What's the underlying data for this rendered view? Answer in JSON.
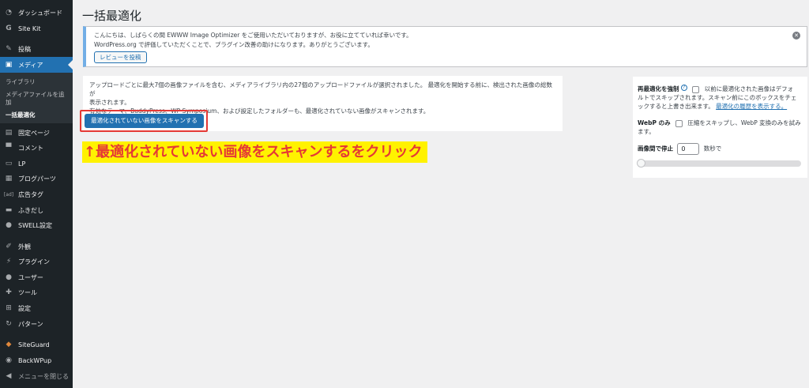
{
  "sidebar": {
    "items": [
      {
        "label": "ダッシュボード",
        "icon": "dashboard-icon"
      },
      {
        "label": "Site Kit",
        "icon": "sitekit-icon"
      },
      {
        "label": "投稿",
        "icon": "pin-icon"
      },
      {
        "label": "メディア",
        "icon": "media-icon"
      },
      {
        "label": "固定ページ",
        "icon": "page-icon"
      },
      {
        "label": "コメント",
        "icon": "comment-icon"
      },
      {
        "label": "LP",
        "icon": "lp-icon"
      },
      {
        "label": "ブログパーツ",
        "icon": "blogparts-icon"
      },
      {
        "label": "広告タグ",
        "icon": "ad-icon"
      },
      {
        "label": "ふきだし",
        "icon": "balloon-icon"
      },
      {
        "label": "SWELL設定",
        "icon": "swell-icon"
      },
      {
        "label": "外観",
        "icon": "brush-icon"
      },
      {
        "label": "プラグイン",
        "icon": "plugin-icon"
      },
      {
        "label": "ユーザー",
        "icon": "user-icon"
      },
      {
        "label": "ツール",
        "icon": "wrench-icon"
      },
      {
        "label": "設定",
        "icon": "settings-icon"
      },
      {
        "label": "パターン",
        "icon": "pattern-icon"
      },
      {
        "label": "SiteGuard",
        "icon": "siteguard-icon"
      },
      {
        "label": "BackWPup",
        "icon": "backwpup-icon"
      },
      {
        "label": "メニューを閉じる",
        "icon": "collapse-icon"
      }
    ],
    "media_sub": [
      "ライブラリ",
      "メディアファイルを追",
      "加",
      "一括最適化"
    ]
  },
  "page_title": "一括最適化",
  "notice": {
    "line1": "こんにちは、しばらくの間 EWWW Image Optimizer をご使用いただいておりますが、お役に立てていれば幸いです。",
    "line2": "WordPress.org で評価していただくことで、プラグイン改善の助けになります。ありがとうございます。",
    "review_button": "レビューを投稿",
    "close": "✕"
  },
  "scan": {
    "line1": "アップロードごとに最大7個の画像ファイルを含む、メディアライブラリ内の27個のアップロードファイルが選択されました。 最適化を開始する前に、検出された画像の総数が",
    "line2": "表示されます。",
    "line3": "有効なテーマ、BuddyPress、WP Symposium、および設定したフォルダーも、最適化されていない画像がスキャンされます。",
    "button": "最適化されていない画像をスキャンする"
  },
  "annotation": "↑最適化されていない画像をスキャンするをクリック",
  "side": {
    "force_label": "再最適化を強制",
    "help": "?",
    "force_text1": "以前に最適化された画像はデフォ",
    "force_text2": "ルトでスキップされます。スキャン前にこのボックスをチェ",
    "force_text3": "ックすると上書き出来ます。",
    "history_link": "最適化の履歴を表示する。",
    "webp_label": "WebP のみ",
    "webp_text1": "圧縮をスキップし、WebP 変換のみを試み",
    "webp_text2": "ます。",
    "delay_label": "画像間で停止",
    "delay_value": "0",
    "delay_unit": "数秒で"
  },
  "colors": {
    "sidebar_bg": "#1d2327",
    "accent": "#2271b1",
    "annotation_bg": "#fff200",
    "annotation_text": "#e53935"
  }
}
